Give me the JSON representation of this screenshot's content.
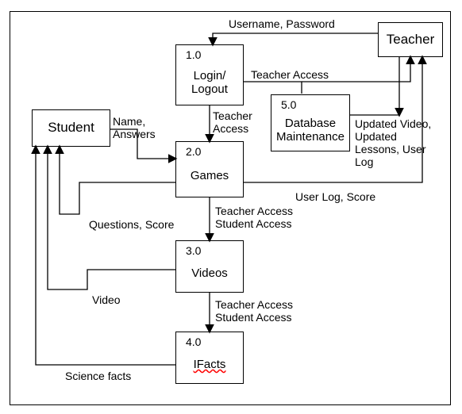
{
  "entities": {
    "student": {
      "label": "Student"
    },
    "teacher": {
      "label": "Teacher"
    }
  },
  "processes": {
    "p1": {
      "num": "1.0",
      "title": "Login/\nLogout"
    },
    "p2": {
      "num": "2.0",
      "title": "Games"
    },
    "p3": {
      "num": "3.0",
      "title": "Videos"
    },
    "p4": {
      "num": "4.0",
      "title": "IFacts"
    },
    "p5": {
      "num": "5.0",
      "title": "Database\nMaintenance"
    }
  },
  "flows": {
    "f_user_pass": "Username, Password",
    "f_teacher_acc_1": "Teacher Access",
    "f_teacher_acc_12": "Teacher\nAccess",
    "f_name_ans": "Name,\nAnswers",
    "f_updated": "Updated Video,\nUpdated\nLessons, User\nLog",
    "f_userlog_score": "User Log, Score",
    "f_q_score": "Questions, Score",
    "f_tasa_23": "Teacher Access\nStudent Access",
    "f_video": "Video",
    "f_tasa_34": "Teacher Access\nStudent Access",
    "f_science": "Science facts"
  }
}
